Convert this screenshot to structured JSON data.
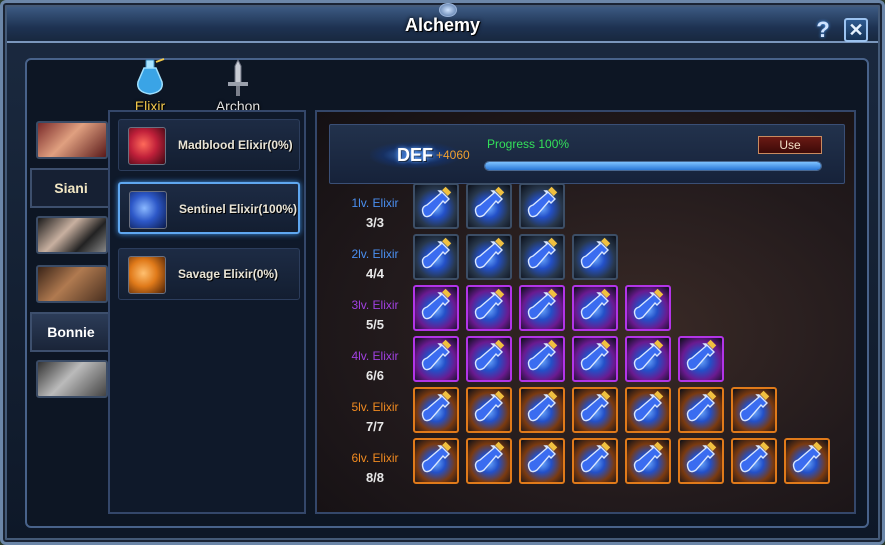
{
  "window": {
    "title": "Alchemy",
    "help_glyph": "?",
    "close_glyph": "✕"
  },
  "top_tabs": [
    {
      "label": "Elixir",
      "icon": "elixir-bottle-icon",
      "active": true,
      "color": "#f2c94c"
    },
    {
      "label": "Archon",
      "icon": "archon-sword-icon",
      "active": false,
      "color": "#e0e0e0"
    }
  ],
  "heroes": [
    {
      "type": "portrait",
      "name": "red-haired-hero-portrait"
    },
    {
      "type": "name",
      "label": "Siani",
      "active": true
    },
    {
      "type": "portrait",
      "name": "masked-hero-portrait"
    },
    {
      "type": "portrait",
      "name": "bearded-hero-portrait"
    },
    {
      "type": "name",
      "label": "Bonnie",
      "active": false
    },
    {
      "type": "portrait",
      "name": "grey-haired-hero-portrait"
    }
  ],
  "elixirs": [
    {
      "label": "Madblood Elixir(0%)",
      "icon": "madblood-elixir-icon",
      "color": "#c0203a",
      "selected": false
    },
    {
      "label": "Sentinel Elixir(100%)",
      "icon": "sentinel-elixir-icon",
      "color": "#2d58c8",
      "selected": true
    },
    {
      "label": "Savage Elixir(0%)",
      "icon": "savage-elixir-icon",
      "color": "#e07a1a",
      "selected": false
    }
  ],
  "detail": {
    "stat": "DEF",
    "bonus": "+4060",
    "progress_label": "Progress 100%",
    "progress": 1.0,
    "use_label": "Use"
  },
  "levels": [
    {
      "label": "1lv. Elixir",
      "count": "3/3",
      "slots": 3,
      "label_color": "#4a8ff0",
      "frame": "#3c4e66",
      "glow": "#28384d"
    },
    {
      "label": "2lv. Elixir",
      "count": "4/4",
      "slots": 4,
      "label_color": "#4a8ff0",
      "frame": "#3c4e66",
      "glow": "#28384d"
    },
    {
      "label": "3lv. Elixir",
      "count": "5/5",
      "slots": 5,
      "label_color": "#a040e0",
      "frame": "#b234e8",
      "glow": "#6a1a90"
    },
    {
      "label": "4lv. Elixir",
      "count": "6/6",
      "slots": 6,
      "label_color": "#a040e0",
      "frame": "#b234e8",
      "glow": "#6a1a90"
    },
    {
      "label": "5lv. Elixir",
      "count": "7/7",
      "slots": 7,
      "label_color": "#f08a20",
      "frame": "#e07a1a",
      "glow": "#7a3a10"
    },
    {
      "label": "6lv. Elixir",
      "count": "8/8",
      "slots": 8,
      "label_color": "#f08a20",
      "frame": "#e07a1a",
      "glow": "#7a3a10"
    }
  ]
}
